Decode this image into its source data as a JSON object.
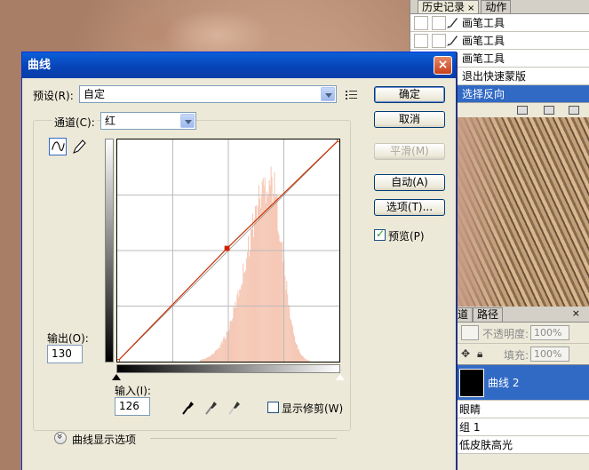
{
  "history": {
    "tabs": [
      "历史记录",
      "动作"
    ],
    "tab_close": "×",
    "items": [
      {
        "label": "画笔工具",
        "icon": "brush-icon"
      },
      {
        "label": "画笔工具",
        "icon": "brush-icon"
      },
      {
        "label": "画笔工具",
        "icon": "brush-icon"
      },
      {
        "label": "退出快速蒙版",
        "icon": "none"
      },
      {
        "label": "选择反向",
        "icon": "none",
        "selected": true
      }
    ]
  },
  "layers": {
    "tabs": [
      "道",
      "路径"
    ],
    "opacity_label": "不透明度:",
    "opacity_value": "100%",
    "fill_label": "填充:",
    "fill_value": "100%",
    "items": [
      {
        "label": "曲线 2",
        "selected": true
      },
      {
        "label": "眼睛"
      },
      {
        "label": "组 1"
      },
      {
        "label": "低皮肤高光"
      }
    ]
  },
  "dialog": {
    "title": "曲线",
    "close_glyph": "×",
    "preset_label": "预设(R):",
    "preset_value": "自定",
    "channel_label": "通道(C):",
    "channel_value": "红",
    "output_label": "输出(O):",
    "output_value": "130",
    "input_label": "输入(I):",
    "input_value": "126",
    "show_clipping_label": "显示修剪(W)",
    "show_clipping_checked": false,
    "curve_options_label": "曲线显示选项",
    "buttons": {
      "ok": "确定",
      "cancel": "取消",
      "smooth": "平滑(M)",
      "auto": "自动(A)",
      "options": "选项(T)..."
    },
    "preview_label": "预览(P)",
    "preview_checked": true
  },
  "chart_data": {
    "type": "area",
    "title": "",
    "xlabel": "输入",
    "ylabel": "输出",
    "xlim": [
      0,
      255
    ],
    "ylim": [
      0,
      255
    ],
    "grid": true,
    "curve_points": [
      [
        0,
        0
      ],
      [
        126,
        130
      ],
      [
        255,
        255
      ]
    ],
    "curve_color": "#c83000",
    "histogram_color": "#f6c8b6",
    "histogram_peak_at": 175,
    "histogram_note_visible": false
  },
  "colors": {
    "accent": "#316ac5",
    "title_bar": "#0842b5",
    "dialog_bg": "#ece9d8"
  }
}
